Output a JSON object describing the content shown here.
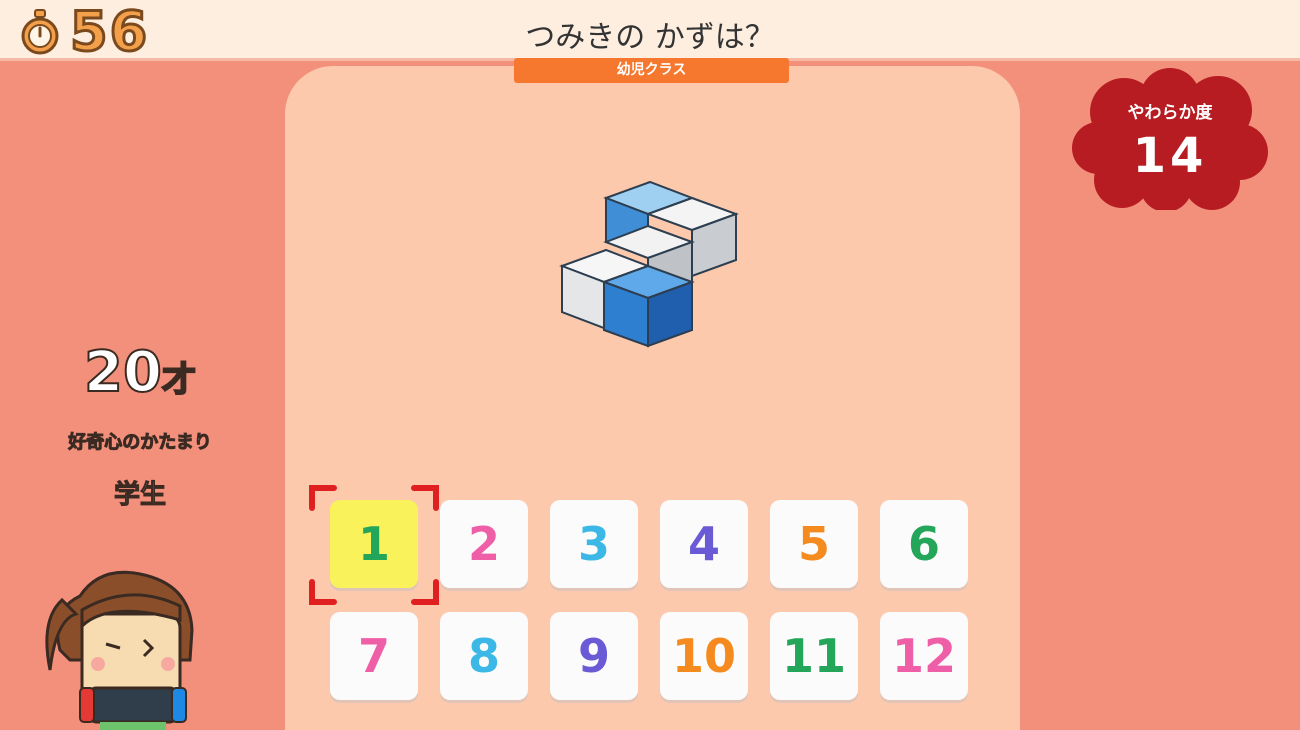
{
  "hud": {
    "timer": "56",
    "question": "つみきの かずは？",
    "class_label": "幼児クラス"
  },
  "softness": {
    "label": "やわらか度",
    "value": "14"
  },
  "player": {
    "age": "20",
    "age_unit": "才",
    "persona": "好奇心のかたまり",
    "job": "学生"
  },
  "answers": [
    {
      "label": "1",
      "color": "#23a55a"
    },
    {
      "label": "2",
      "color": "#ee5fa8"
    },
    {
      "label": "3",
      "color": "#3bb8e6"
    },
    {
      "label": "4",
      "color": "#6a5ad6"
    },
    {
      "label": "5",
      "color": "#f58a1f"
    },
    {
      "label": "6",
      "color": "#23a55a"
    },
    {
      "label": "7",
      "color": "#ee5fa8"
    },
    {
      "label": "8",
      "color": "#3bb8e6"
    },
    {
      "label": "9",
      "color": "#6a5ad6"
    },
    {
      "label": "10",
      "color": "#f58a1f"
    },
    {
      "label": "11",
      "color": "#23a55a"
    },
    {
      "label": "12",
      "color": "#ee5fa8"
    }
  ],
  "selected_answer": "1",
  "colors": {
    "background": "#f3907c",
    "panel": "#fcc9ad",
    "badge": "#f5782e",
    "cloud": "#b71c22",
    "selected": "#f9f25a"
  }
}
